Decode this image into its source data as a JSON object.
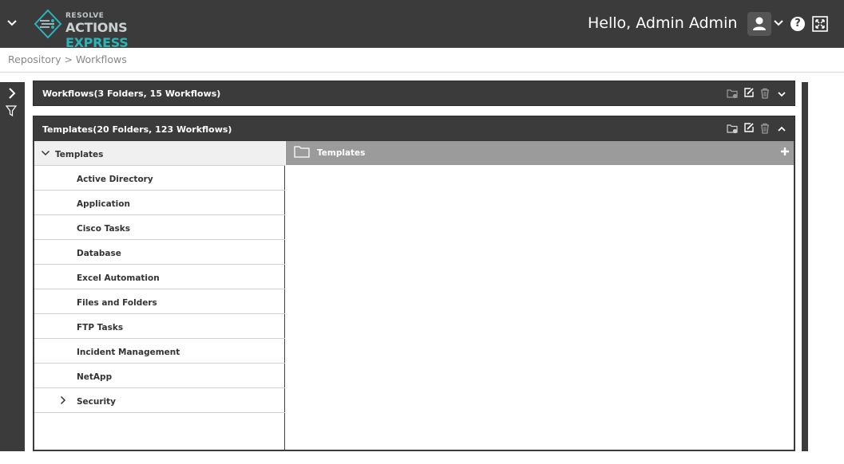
{
  "header": {
    "logo_top": "RESOLVE",
    "logo_main": "ACTIONS",
    "logo_accent": "EXPRESS",
    "greeting": "Hello, Admin Admin",
    "help_glyph": "?",
    "accent_color": "#2bb5b8",
    "bar_color": "#3b3b3b"
  },
  "breadcrumb": {
    "text": "Repository > Workflows"
  },
  "panels": {
    "workflows": {
      "title": "Workflows(3 Folders, 15 Workflows)",
      "expanded": false
    },
    "templates": {
      "title": "Templates(20 Folders, 123 Workflows)",
      "expanded": true
    }
  },
  "tree": {
    "root": "Templates",
    "items": [
      {
        "label": "Active Directory",
        "has_children": false
      },
      {
        "label": "Application",
        "has_children": false
      },
      {
        "label": "Cisco Tasks",
        "has_children": false
      },
      {
        "label": "Database",
        "has_children": false
      },
      {
        "label": "Excel Automation",
        "has_children": false
      },
      {
        "label": "Files and Folders",
        "has_children": false
      },
      {
        "label": "FTP Tasks",
        "has_children": false
      },
      {
        "label": "Incident Management",
        "has_children": false
      },
      {
        "label": "NetApp",
        "has_children": false
      },
      {
        "label": "Security",
        "has_children": true
      }
    ]
  },
  "content": {
    "header_label": "Templates"
  },
  "icons": [
    "menu-chevron-icon",
    "logo-icon",
    "user-icon",
    "chevron-down-icon",
    "help-icon",
    "fullscreen-icon",
    "expand-rail-icon",
    "filter-icon",
    "new-folder-icon",
    "edit-icon",
    "delete-icon",
    "collapse-icon",
    "folder-icon",
    "plus-icon"
  ]
}
